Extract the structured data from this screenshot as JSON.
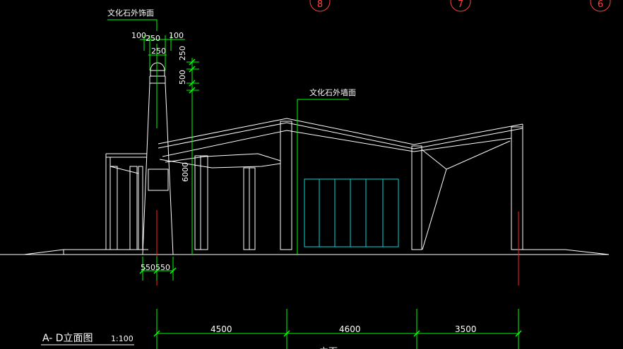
{
  "drawing": {
    "title": "A- D立面图",
    "scale": "1:100",
    "bottom_label": "立面"
  },
  "annotations": {
    "tower_material": "文化石外饰面",
    "wall_material": "文化石外墙面"
  },
  "grid_axes": [
    "8",
    "7",
    "6"
  ],
  "dimensions": {
    "top_left": "100",
    "top_mid": "250",
    "top_right": "100",
    "top_lower": "250",
    "vertical_top": "250",
    "vertical_mid": "500",
    "vertical_height": "6000",
    "base_widths": "550550",
    "spans": [
      "4500",
      "4600",
      "3500"
    ]
  },
  "colors": {
    "background": "#000000",
    "lines": "#ffffff",
    "dimension": "#00ff00",
    "axis": "#ff0000",
    "glazing": "#00d7d7"
  }
}
